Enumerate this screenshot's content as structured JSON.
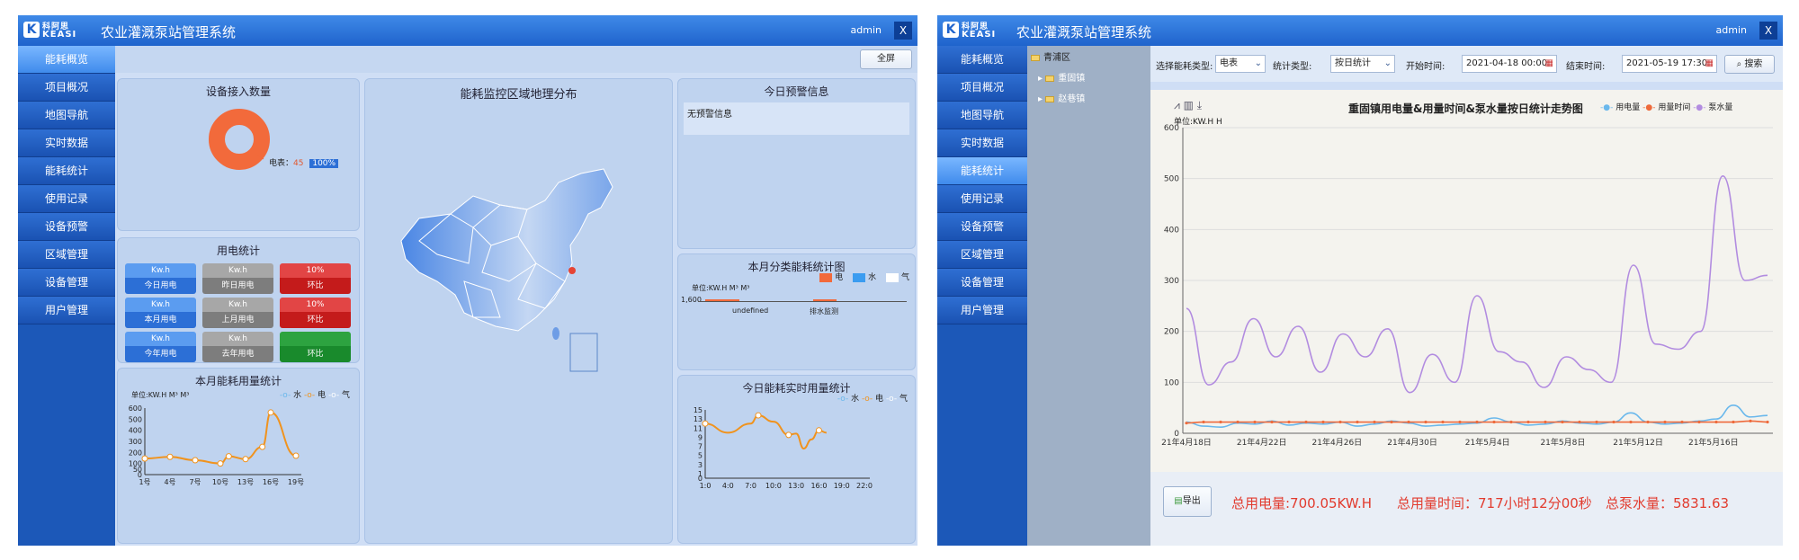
{
  "app": {
    "title": "农业灌溉泵站管理系统",
    "user": "admin",
    "close": "X",
    "logo_cn": "科阿思",
    "logo_en": "KEASI"
  },
  "nav": [
    "能耗概览",
    "项目概况",
    "地图导航",
    "实时数据",
    "能耗统计",
    "使用记录",
    "设备预警",
    "区域管理",
    "设备管理",
    "用户管理"
  ],
  "dash": {
    "fullscreen": "全屏",
    "device_panel": {
      "title": "设备接入数量",
      "label": "电表：",
      "count": "45",
      "pct": "100%"
    },
    "map_title": "能耗监控区域地理分布",
    "alarm_panel": {
      "title": "今日预警信息",
      "empty": "无预警信息"
    },
    "power_stats": {
      "title": "用电统计",
      "cells": [
        {
          "top": "Kw.h",
          "bottom": "今日用电",
          "top_color": "#5b9cf0",
          "bottom_color": "#2c6fd6"
        },
        {
          "top": "Kw.h",
          "bottom": "昨日用电",
          "top_color": "#a7a7a7",
          "bottom_color": "#7d7d7d"
        },
        {
          "top": "10%",
          "bottom": "环比",
          "top_color": "#e24545",
          "bottom_color": "#c41b1b"
        },
        {
          "top": "Kw.h",
          "bottom": "本月用电",
          "top_color": "#5b9cf0",
          "bottom_color": "#2c6fd6"
        },
        {
          "top": "Kw.h",
          "bottom": "上月用电",
          "top_color": "#a7a7a7",
          "bottom_color": "#7d7d7d"
        },
        {
          "top": "10%",
          "bottom": "环比",
          "top_color": "#e24545",
          "bottom_color": "#c41b1b"
        },
        {
          "top": "Kw.h",
          "bottom": "今年用电",
          "top_color": "#5b9cf0",
          "bottom_color": "#2c6fd6"
        },
        {
          "top": "Kw.h",
          "bottom": "去年用电",
          "top_color": "#a7a7a7",
          "bottom_color": "#7d7d7d"
        },
        {
          "top": "",
          "bottom": "环比",
          "top_color": "#2da340",
          "bottom_color": "#198a2c"
        }
      ]
    },
    "month_usage": {
      "title": "本月能耗用量统计",
      "unit": "单位:KW.H  M³ M³",
      "legend": [
        "水",
        "电",
        "气"
      ]
    },
    "month_category": {
      "title": "本月分类能耗统计图",
      "unit": "单位:KW.H  M³ M³",
      "legend": [
        "电",
        "水",
        "气"
      ],
      "ytick": "1,600",
      "xlabels": [
        "undefined",
        "排水监测"
      ]
    },
    "today_usage": {
      "title": "今日能耗实时用量统计",
      "legend": [
        "水",
        "电",
        "气"
      ]
    }
  },
  "query": {
    "tree": {
      "root": "青浦区",
      "children": [
        "重固镇",
        "赵巷镇"
      ]
    },
    "type_label": "选择能耗类型:",
    "type_value": "电表",
    "stat_label": "统计类型:",
    "stat_value": "按日统计",
    "start_label": "开始时间:",
    "start_value": "2021-04-18 00:00",
    "end_label": "结束时间:",
    "end_value": "2021-05-19 17:30",
    "search": "搜索",
    "chart_title": "重固镇用电量&用量时间&泵水量按日统计走势图",
    "unit": "单位:KW.H  H",
    "export": "导出",
    "stats": [
      "总用电量:700.05KW.H",
      "总用量时间：717小时12分00秒",
      "总泵水量：5831.63"
    ]
  },
  "chart_data": [
    {
      "type": "line",
      "title": "本月能耗用量统计",
      "categories": [
        "1号",
        "4号",
        "7号",
        "10号",
        "13号",
        "16号",
        "19号"
      ],
      "ylim": [
        0,
        600
      ],
      "yticks": [
        0,
        50,
        100,
        200,
        300,
        400,
        500,
        600
      ],
      "x": [
        1,
        4,
        7,
        10,
        13,
        16,
        19
      ],
      "series": [
        {
          "name": "电",
          "color": "#f0931e",
          "x": [
            1,
            4,
            7,
            10,
            11,
            13,
            15,
            16,
            19
          ],
          "values": [
            145,
            160,
            130,
            100,
            165,
            140,
            250,
            560,
            170
          ]
        }
      ]
    },
    {
      "type": "line",
      "title": "今日能耗实时用量统计",
      "categories": [
        "1:0",
        "4:0",
        "7:0",
        "10:0",
        "13:0",
        "16:0",
        "19:0",
        "22:0"
      ],
      "ylim": [
        0,
        15
      ],
      "yticks": [
        0,
        1,
        3,
        5,
        7,
        9,
        11,
        13,
        15
      ],
      "series": [
        {
          "name": "电",
          "color": "#f0931e",
          "x": [
            1,
            4,
            7,
            8,
            10,
            12,
            13,
            14,
            15,
            16,
            17
          ],
          "values": [
            12,
            10,
            12,
            13.8,
            12.4,
            9.5,
            9.8,
            6.5,
            8.5,
            10.5,
            10
          ]
        }
      ]
    },
    {
      "type": "line",
      "title": "重固镇用电量&用量时间&泵水量按日统计走势图",
      "categories": [
        "21年4月18日",
        "21年4月22日",
        "21年4月26日",
        "21年4月30日",
        "21年5月4日",
        "21年5月8日",
        "21年5月12日",
        "21年5月16日"
      ],
      "ylim": [
        0,
        600
      ],
      "yticks": [
        0,
        100,
        200,
        300,
        400,
        500,
        600
      ],
      "series": [
        {
          "name": "用电量",
          "color": "#6ab8ec",
          "values": [
            22,
            14,
            12,
            20,
            18,
            24,
            16,
            20,
            18,
            22,
            14,
            18,
            24,
            20,
            14,
            16,
            18,
            20,
            30,
            22,
            16,
            18,
            24,
            20,
            18,
            22,
            40,
            22,
            18,
            20,
            24,
            28,
            55,
            32,
            35
          ]
        },
        {
          "name": "用量时间",
          "color": "#ee6a3b",
          "values": [
            20,
            22,
            22,
            22,
            22,
            22,
            22,
            22,
            22,
            22,
            22,
            22,
            22,
            22,
            22,
            22,
            22,
            22,
            22,
            22,
            22,
            22,
            22,
            22,
            22,
            22,
            22,
            22,
            22,
            22,
            22,
            22,
            22,
            24,
            22
          ]
        },
        {
          "name": "泵水量",
          "color": "#b28ce0",
          "values": [
            245,
            95,
            140,
            225,
            150,
            210,
            120,
            195,
            150,
            205,
            80,
            155,
            100,
            270,
            160,
            140,
            90,
            150,
            125,
            100,
            330,
            175,
            165,
            200,
            505,
            300,
            310
          ]
        }
      ]
    }
  ]
}
